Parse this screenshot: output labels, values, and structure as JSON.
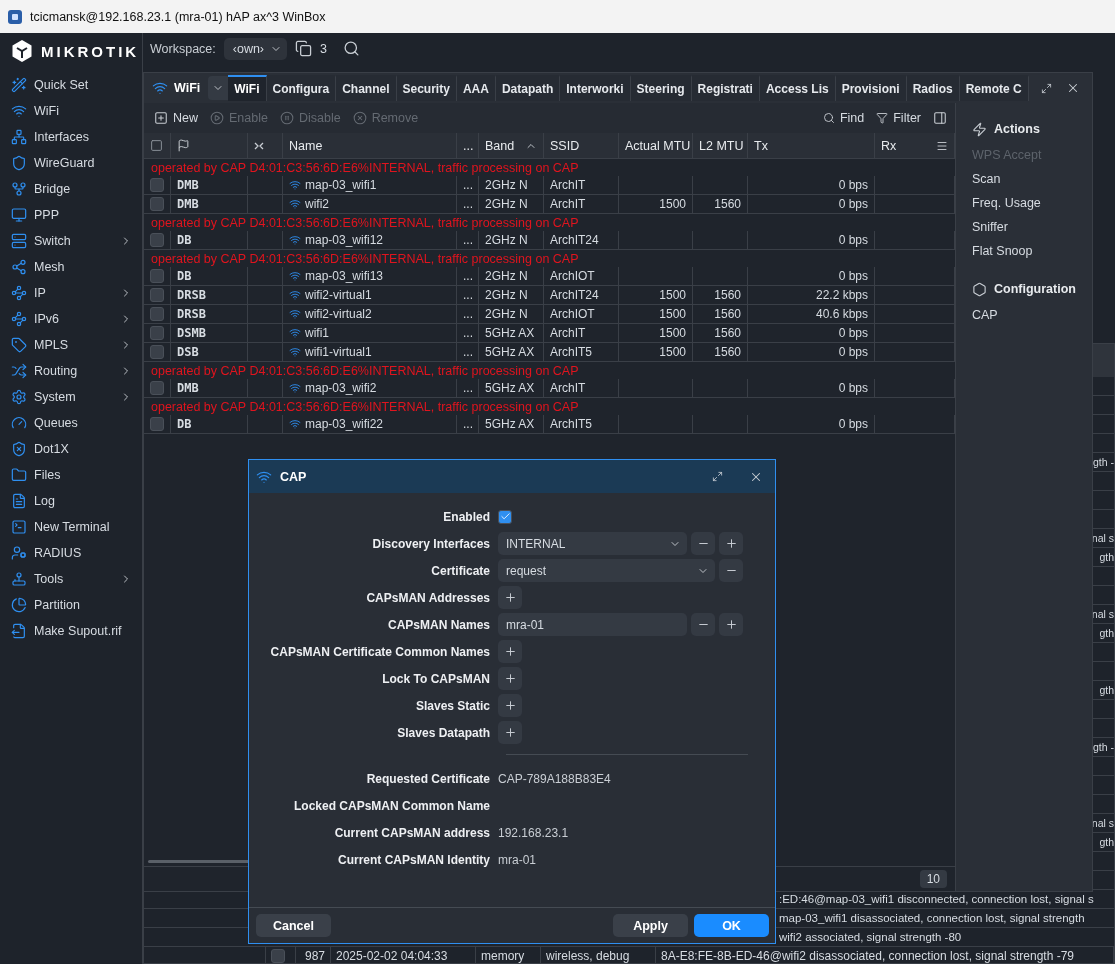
{
  "window": {
    "title": "tcicmansk@192.168.23.1 (mra-01) hAP ax^3 WinBox"
  },
  "sidebar": {
    "logo": "MIKROTIK",
    "items": [
      {
        "label": "Quick Set",
        "has_submenu": false
      },
      {
        "label": "WiFi",
        "has_submenu": false
      },
      {
        "label": "Interfaces",
        "has_submenu": false
      },
      {
        "label": "WireGuard",
        "has_submenu": false
      },
      {
        "label": "Bridge",
        "has_submenu": false
      },
      {
        "label": "PPP",
        "has_submenu": false
      },
      {
        "label": "Switch",
        "has_submenu": true
      },
      {
        "label": "Mesh",
        "has_submenu": false
      },
      {
        "label": "IP",
        "has_submenu": true
      },
      {
        "label": "IPv6",
        "has_submenu": true
      },
      {
        "label": "MPLS",
        "has_submenu": true
      },
      {
        "label": "Routing",
        "has_submenu": true
      },
      {
        "label": "System",
        "has_submenu": true
      },
      {
        "label": "Queues",
        "has_submenu": false
      },
      {
        "label": "Dot1X",
        "has_submenu": false
      },
      {
        "label": "Files",
        "has_submenu": false
      },
      {
        "label": "Log",
        "has_submenu": false
      },
      {
        "label": "New Terminal",
        "has_submenu": false
      },
      {
        "label": "RADIUS",
        "has_submenu": false
      },
      {
        "label": "Tools",
        "has_submenu": true
      },
      {
        "label": "Partition",
        "has_submenu": false
      },
      {
        "label": "Make Supout.rif",
        "has_submenu": false
      }
    ]
  },
  "workspace": {
    "label": "Workspace:",
    "value": "‹own›",
    "window_count": "3"
  },
  "wifi_window": {
    "title": "WiFi",
    "tabs": [
      {
        "label": "WiFi",
        "selected": true
      },
      {
        "label": "Configura",
        "selected": false
      },
      {
        "label": "Channel",
        "selected": false
      },
      {
        "label": "Security",
        "selected": false
      },
      {
        "label": "AAA",
        "selected": false
      },
      {
        "label": "Datapath",
        "selected": false
      },
      {
        "label": "Interworki",
        "selected": false
      },
      {
        "label": "Steering",
        "selected": false
      },
      {
        "label": "Registrati",
        "selected": false
      },
      {
        "label": "Access Lis",
        "selected": false
      },
      {
        "label": "Provisioni",
        "selected": false
      },
      {
        "label": "Radios",
        "selected": false
      },
      {
        "label": "Remote C",
        "selected": false
      }
    ],
    "toolbar": [
      {
        "label": "New",
        "disabled": false
      },
      {
        "label": "Enable",
        "disabled": true
      },
      {
        "label": "Disable",
        "disabled": true
      },
      {
        "label": "Remove",
        "disabled": true
      }
    ],
    "find": "Find",
    "filter": "Filter",
    "columns": [
      "Name",
      "...",
      "Band",
      "SSID",
      "Actual MTU",
      "L2 MTU",
      "Tx",
      "Rx"
    ],
    "rows": [
      {
        "kind": "note",
        "text": "operated by CAP D4:01:C3:56:6D:E6%INTERNAL, traffic processing on CAP"
      },
      {
        "kind": "interface",
        "checked": false,
        "flags": "DMB",
        "name": "map-03_wifi1",
        "more": "...",
        "band": "2GHz N",
        "ssid": "ArchIT",
        "tx": "0 bps"
      },
      {
        "kind": "interface",
        "checked": false,
        "flags": "DMB",
        "name": "wifi2",
        "more": "...",
        "band": "2GHz N",
        "ssid": "ArchIT",
        "actual_mtu": "1500",
        "l2_mtu": "1560",
        "tx": "0 bps"
      },
      {
        "kind": "note",
        "text": "operated by CAP D4:01:C3:56:6D:E6%INTERNAL, traffic processing on CAP"
      },
      {
        "kind": "interface",
        "checked": false,
        "flags": "DB",
        "name": "map-03_wifi12",
        "more": "...",
        "band": "2GHz N",
        "ssid": "ArchIT24",
        "tx": "0 bps"
      },
      {
        "kind": "note",
        "text": "operated by CAP D4:01:C3:56:6D:E6%INTERNAL, traffic processing on CAP"
      },
      {
        "kind": "interface",
        "checked": false,
        "flags": "DB",
        "name": "map-03_wifi13",
        "more": "...",
        "band": "2GHz N",
        "ssid": "ArchIOT",
        "tx": "0 bps"
      },
      {
        "kind": "interface",
        "checked": false,
        "flags": "DRSB",
        "name": "wifi2-virtual1",
        "more": "...",
        "band": "2GHz N",
        "ssid": "ArchIT24",
        "actual_mtu": "1500",
        "l2_mtu": "1560",
        "tx": "22.2 kbps"
      },
      {
        "kind": "interface",
        "checked": false,
        "flags": "DRSB",
        "name": "wifi2-virtual2",
        "more": "...",
        "band": "2GHz N",
        "ssid": "ArchIOT",
        "actual_mtu": "1500",
        "l2_mtu": "1560",
        "tx": "40.6 kbps"
      },
      {
        "kind": "interface",
        "checked": false,
        "flags": "DSMB",
        "name": "wifi1",
        "more": "...",
        "band": "5GHz AX",
        "ssid": "ArchIT",
        "actual_mtu": "1500",
        "l2_mtu": "1560",
        "tx": "0 bps"
      },
      {
        "kind": "interface",
        "checked": false,
        "flags": "DSB",
        "name": "wifi1-virtual1",
        "more": "...",
        "band": "5GHz AX",
        "ssid": "ArchIT5",
        "actual_mtu": "1500",
        "l2_mtu": "1560",
        "tx": "0 bps"
      },
      {
        "kind": "note",
        "text": "operated by CAP D4:01:C3:56:6D:E6%INTERNAL, traffic processing on CAP"
      },
      {
        "kind": "interface",
        "checked": false,
        "flags": "DMB",
        "name": "map-03_wifi2",
        "more": "...",
        "band": "5GHz AX",
        "ssid": "ArchIT",
        "tx": "0 bps"
      },
      {
        "kind": "note",
        "text": "operated by CAP D4:01:C3:56:6D:E6%INTERNAL, traffic processing on CAP"
      },
      {
        "kind": "interface",
        "checked": false,
        "flags": "DB",
        "name": "map-03_wifi22",
        "more": "...",
        "band": "5GHz AX",
        "ssid": "ArchIT5",
        "tx": "0 bps"
      }
    ],
    "item_count": "10",
    "panel": [
      {
        "title": "Actions",
        "items": [
          {
            "label": "WPS Accept",
            "disabled": true
          },
          {
            "label": "Scan",
            "disabled": false
          },
          {
            "label": "Freq. Usage",
            "disabled": false
          },
          {
            "label": "Sniffer",
            "disabled": false
          },
          {
            "label": "Flat Snoop",
            "disabled": false
          }
        ]
      },
      {
        "title": "Configuration",
        "items": [
          {
            "label": "CAP",
            "disabled": false
          }
        ]
      }
    ]
  },
  "log_window": {
    "rows": [
      {
        "kind": "blank"
      },
      {
        "kind": "blank"
      },
      {
        "kind": "blank"
      },
      {
        "kind": "blank"
      },
      {
        "kind": "tail",
        "text": "gth -"
      },
      {
        "kind": "blank"
      },
      {
        "kind": "blank"
      },
      {
        "kind": "blank"
      },
      {
        "kind": "tail",
        "text": "nal s"
      },
      {
        "kind": "tail",
        "text": "gth"
      },
      {
        "kind": "blank"
      },
      {
        "kind": "blank"
      },
      {
        "kind": "tail",
        "text": "nal s"
      },
      {
        "kind": "tail",
        "text": "gth"
      },
      {
        "kind": "blank"
      },
      {
        "kind": "blank"
      },
      {
        "kind": "tail",
        "text": "gth"
      },
      {
        "kind": "blank"
      },
      {
        "kind": "blank"
      },
      {
        "kind": "tail",
        "text": "gth -"
      },
      {
        "kind": "blank"
      },
      {
        "kind": "blank"
      },
      {
        "kind": "blank"
      },
      {
        "kind": "tail",
        "text": "nal s"
      },
      {
        "kind": "tail",
        "text": "gth"
      },
      {
        "kind": "blank"
      },
      {
        "kind": "blank"
      },
      {
        "kind": "partial",
        "text": ":ED:46@map-03_wifi1 disconnected, connection lost, signal s"
      },
      {
        "kind": "partial",
        "text": "map-03_wifi1 disassociated, connection lost, signal strength"
      },
      {
        "kind": "partial",
        "text": "wifi2 associated, signal strength -80"
      },
      {
        "kind": "entry",
        "checked": false,
        "number": "987",
        "time": "2025-02-02 04:04:33",
        "buffer": "memory",
        "topics": "wireless, debug",
        "message": "8A-E8:FE-8B-ED-46@wifi2 disassociated, connection lost, signal strength -79"
      }
    ]
  },
  "cap_dialog": {
    "title": "CAP",
    "fields": [
      {
        "kind": "checkbox",
        "label": "Enabled",
        "checked": true
      },
      {
        "kind": "select",
        "label": "Discovery Interfaces",
        "value": "INTERNAL",
        "removable": true,
        "addable": true
      },
      {
        "kind": "select",
        "label": "Certificate",
        "value": "request",
        "removable": true,
        "addable": false
      },
      {
        "kind": "list",
        "label": "CAPsMAN Addresses",
        "removable": false,
        "addable": true
      },
      {
        "kind": "input",
        "label": "CAPsMAN Names",
        "value": "mra-01",
        "removable": true,
        "addable": true
      },
      {
        "kind": "list",
        "label": "CAPsMAN Certificate Common Names",
        "removable": false,
        "addable": true
      },
      {
        "kind": "list",
        "label": "Lock To CAPsMAN",
        "removable": false,
        "addable": true
      },
      {
        "kind": "list",
        "label": "Slaves Static",
        "removable": false,
        "addable": true
      },
      {
        "kind": "list",
        "label": "Slaves Datapath",
        "removable": false,
        "addable": true
      }
    ],
    "info": [
      {
        "label": "Requested Certificate",
        "value": "CAP-789A188B83E4"
      },
      {
        "label": "Locked CAPsMAN Common Name"
      },
      {
        "label": "Current CAPsMAN address",
        "value": "192.168.23.1"
      },
      {
        "label": "Current CAPsMAN Identity",
        "value": "mra-01"
      }
    ],
    "buttons": [
      {
        "label": "Cancel",
        "kind": "secondary"
      },
      {
        "label": "Apply",
        "kind": "secondary"
      },
      {
        "label": "OK",
        "kind": "primary"
      }
    ]
  }
}
